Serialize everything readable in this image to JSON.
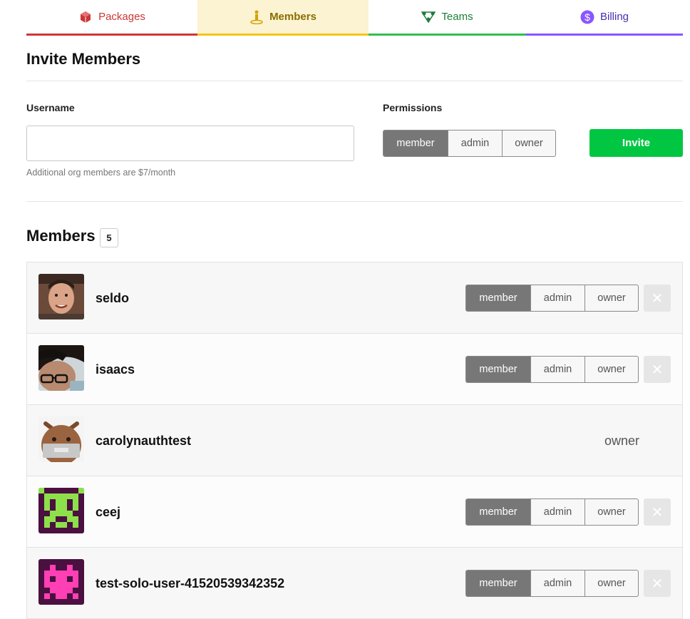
{
  "tabs": [
    {
      "label": "Packages",
      "icon": "package-icon",
      "color": "#cb3837"
    },
    {
      "label": "Members",
      "icon": "member-icon",
      "color": "#f5c518",
      "active": true
    },
    {
      "label": "Teams",
      "icon": "teams-icon",
      "color": "#2fbf4f"
    },
    {
      "label": "Billing",
      "icon": "dollar-icon",
      "color": "#8956ff"
    }
  ],
  "invite": {
    "title": "Invite Members",
    "username_label": "Username",
    "username_value": "",
    "username_placeholder": "",
    "hint": "Additional org members are $7/month",
    "permissions_label": "Permissions",
    "permissions": [
      "member",
      "admin",
      "owner"
    ],
    "selected_permission": "member",
    "button_label": "Invite",
    "button_color": "#00c642"
  },
  "members": {
    "title": "Members",
    "count": "5",
    "rows": [
      {
        "username": "seldo",
        "role": "member",
        "editable": true,
        "options": [
          "member",
          "admin",
          "owner"
        ]
      },
      {
        "username": "isaacs",
        "role": "member",
        "editable": true,
        "options": [
          "member",
          "admin",
          "owner"
        ]
      },
      {
        "username": "carolynauthtest",
        "role": "owner",
        "editable": false
      },
      {
        "username": "ceej",
        "role": "member",
        "editable": true,
        "options": [
          "member",
          "admin",
          "owner"
        ]
      },
      {
        "username": "test-solo-user-41520539342352",
        "role": "member",
        "editable": true,
        "options": [
          "member",
          "admin",
          "owner"
        ]
      }
    ]
  }
}
